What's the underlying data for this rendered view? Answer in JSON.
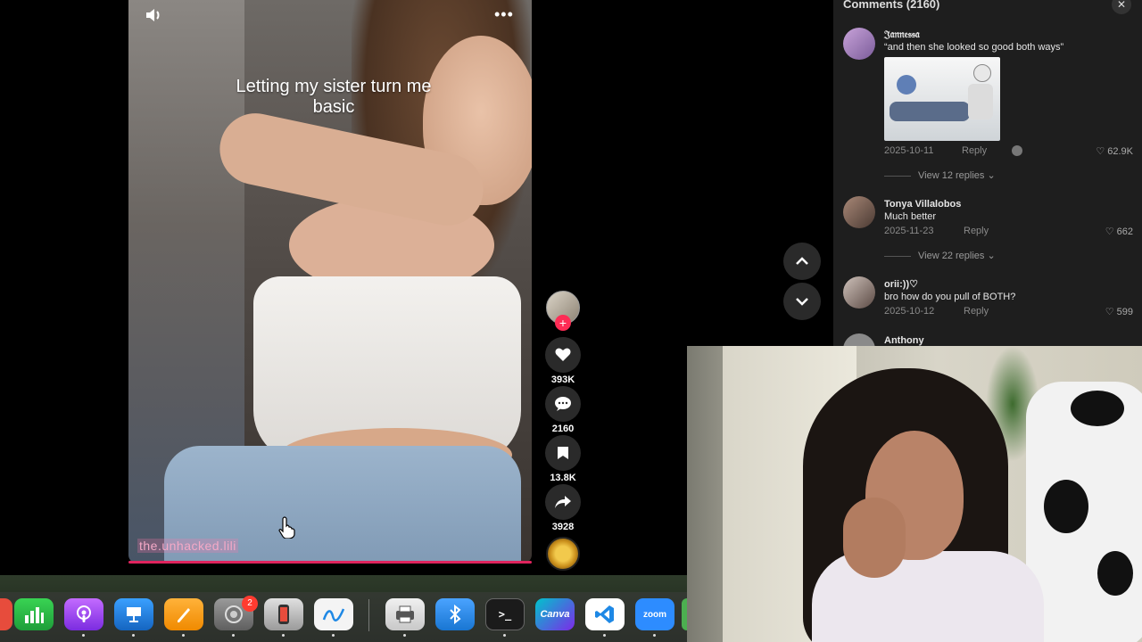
{
  "video": {
    "caption": "Letting my sister turn me basic",
    "watermark": "the.unhacked.lili"
  },
  "actions": {
    "likes": "393K",
    "comments": "2160",
    "saves": "13.8K",
    "shares": "3928"
  },
  "comments_panel": {
    "title": "Comments (2160)",
    "comments": [
      {
        "user": "𝔍𝔞𝔫𝔫𝔢𝔰𝔰𝔞",
        "text": "“and then she looked so good both ways”",
        "date": "2025-10-11",
        "reply_label": "Reply",
        "likes": "62.9K",
        "view_replies": "View 12 replies"
      },
      {
        "user": "Tonya Villalobos",
        "text": "Much better",
        "date": "2025-11-23",
        "reply_label": "Reply",
        "likes": "662",
        "view_replies": "View 22 replies"
      },
      {
        "user": "orii:))♡",
        "text": "bro how do you pull of BOTH?",
        "date": "2025-10-12",
        "reply_label": "Reply",
        "likes": "599"
      },
      {
        "user": "Anthony"
      }
    ]
  },
  "dock": {
    "badge_count": "2",
    "canva_label": "Canva",
    "zoom_label": "zoom"
  }
}
